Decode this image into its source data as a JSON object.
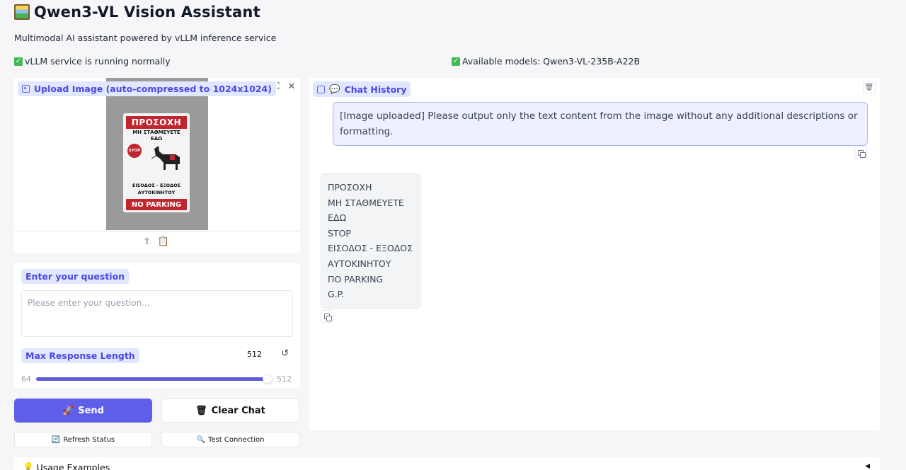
{
  "header": {
    "title": "Qwen3-VL Vision Assistant",
    "subtitle": "Multimodal AI assistant powered by vLLM inference service"
  },
  "status": {
    "service": "vLLM service is running normally",
    "models": "Available models: Qwen3-VL-235B-A22B"
  },
  "upload": {
    "label": "Upload Image (auto-compressed to 1024x1024)",
    "image_text": {
      "header": "ΠΡΟΣΟΧΗ",
      "line1": "ΜΗ ΣΤΑΘΜΕΥΕΤΕ",
      "line2": "ΕΔΩ",
      "stop": "STOP",
      "line3": "ΕΙΣΟΔΟΣ - ΕΞΟΔΟΣ",
      "line4": "ΑΥΤΟΚΙΝΗΤΟΥ",
      "parking": "NO PARKING"
    }
  },
  "question": {
    "label": "Enter your question",
    "placeholder": "Please enter your question..."
  },
  "max_length": {
    "label": "Max Response Length",
    "value": "512",
    "min": "64",
    "max": "512",
    "fraction": 1.0
  },
  "buttons": {
    "send": "Send",
    "clear": "Clear Chat",
    "refresh": "Refresh Status",
    "test": "Test Connection"
  },
  "chat": {
    "label": "Chat History",
    "user_message": "[Image uploaded] Please output only the text content from the image without any additional descriptions or formatting.",
    "bot_lines": [
      "ΠΡΟΣΟΧΗ",
      "ΜΗ ΣΤΑΘΜΕΥΕΤΕ",
      "ΕΔΩ",
      "STOP",
      "ΕΙΣΟΔΟΣ - ΕΞΟΔΟΣ",
      "ΑΥΤΟΚΙΝΗΤΟΥ",
      "ΠΟ PARKING",
      "G.P."
    ]
  },
  "usage": {
    "label": "Usage Examples"
  }
}
